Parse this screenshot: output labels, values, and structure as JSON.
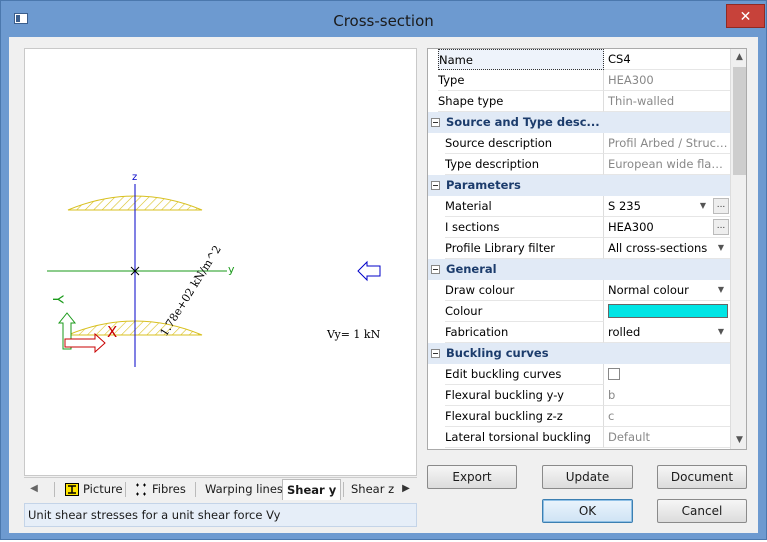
{
  "window": {
    "title": "Cross-section",
    "close_glyph": "✕"
  },
  "preview": {
    "axis_z": "z",
    "axis_y": "y",
    "label_Y": "Y",
    "label_X": "X",
    "stress_label": "1.78e+02 kN/m^2",
    "force_label": "Vy= 1 kN",
    "hatch_color": "#d8c020",
    "axis_color_z": "#0000c8",
    "axis_color_y": "#1a9a1a"
  },
  "tabs": {
    "items": [
      {
        "label": "Picture",
        "icon": "i-beam-icon"
      },
      {
        "label": "Fibres",
        "icon": "fibres-icon"
      },
      {
        "label": "Warping lines"
      },
      {
        "label": "Shear y"
      },
      {
        "label": "Shear z"
      }
    ],
    "active": "Shear y"
  },
  "status_text": "Unit shear stresses for a unit shear force Vy",
  "properties": {
    "rows": [
      {
        "label": "Name",
        "value": "CS4"
      },
      {
        "label": "Type",
        "value": "HEA300"
      },
      {
        "label": "Shape type",
        "value": "Thin-walled"
      },
      {
        "category": "Source and Type desc..."
      },
      {
        "label": "Source description",
        "value": "Profil Arbed / Struct..."
      },
      {
        "label": "Type description",
        "value": "European wide flang..."
      },
      {
        "category": "Parameters"
      },
      {
        "label": "Material",
        "value": "S 235"
      },
      {
        "label": "I sections",
        "value": "HEA300"
      },
      {
        "label": "Profile Library filter",
        "value": "All cross-sections"
      },
      {
        "category": "General"
      },
      {
        "label": "Draw colour",
        "value": "Normal colour"
      },
      {
        "label": "Colour",
        "value": ""
      },
      {
        "label": "Fabrication",
        "value": "rolled"
      },
      {
        "category": "Buckling curves"
      },
      {
        "label": "Edit buckling curves",
        "value": ""
      },
      {
        "label": "Flexural buckling y-y",
        "value": "b"
      },
      {
        "label": "Flexural buckling z-z",
        "value": "c"
      },
      {
        "label": "Lateral torsional buckling",
        "value": "Default"
      }
    ],
    "colour_swatch": "#00e5e5",
    "ellipsis": "..."
  },
  "buttons": {
    "export": "Export",
    "update": "Update",
    "document": "Document",
    "ok": "OK",
    "cancel": "Cancel"
  }
}
